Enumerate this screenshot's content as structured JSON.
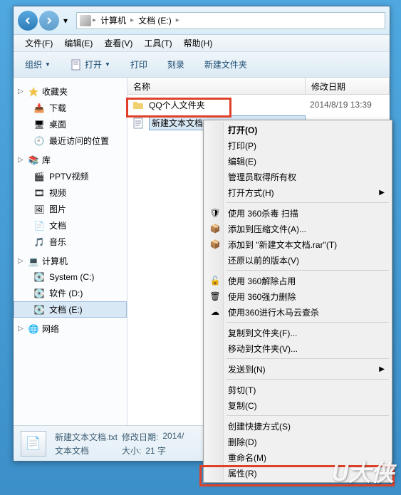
{
  "breadcrumb": {
    "seg1": "计算机",
    "seg2": "文档 (E:)"
  },
  "menubar": {
    "file": "文件(F)",
    "edit": "编辑(E)",
    "view": "查看(V)",
    "tools": "工具(T)",
    "help": "帮助(H)"
  },
  "toolbar": {
    "organize": "组织",
    "open": "打开",
    "print": "打印",
    "burn": "刻录",
    "newfolder": "新建文件夹"
  },
  "sidebar": {
    "favorites": {
      "label": "收藏夹",
      "items": [
        "下载",
        "桌面",
        "最近访问的位置"
      ]
    },
    "libraries": {
      "label": "库",
      "items": [
        "PPTV视频",
        "视频",
        "图片",
        "文档",
        "音乐"
      ]
    },
    "computer": {
      "label": "计算机",
      "items": [
        "System (C:)",
        "软件 (D:)",
        "文档 (E:)"
      ]
    },
    "network": {
      "label": "网络"
    }
  },
  "columns": {
    "name": "名称",
    "date": "修改日期"
  },
  "files": [
    {
      "name": "QQ个人文件夹",
      "date": "2014/8/19 13:39",
      "type": "folder"
    },
    {
      "name": "新建文本文档",
      "date": "",
      "type": "txt",
      "selected": true
    }
  ],
  "status": {
    "filename": "新建文本文档.txt",
    "type": "文本文档",
    "datelabel": "修改日期:",
    "dateval": "2014/",
    "sizelabel": "大小:",
    "sizeval": "21 字"
  },
  "context": {
    "open": "打开(O)",
    "print": "打印(P)",
    "edit": "编辑(E)",
    "admin": "管理员取得所有权",
    "openwith": "打开方式(H)",
    "scan360": "使用 360杀毒 扫描",
    "addarchive": "添加到压缩文件(A)...",
    "addrar": "添加到 \"新建文本文档.rar\"(T)",
    "restore": "还原以前的版本(V)",
    "unlock360": "使用 360解除占用",
    "forcedel360": "使用 360强力删除",
    "cloud360": "使用360进行木马云查杀",
    "copyfolder": "复制到文件夹(F)...",
    "movefolder": "移动到文件夹(V)...",
    "sendto": "发送到(N)",
    "cut": "剪切(T)",
    "copy": "复制(C)",
    "shortcut": "创建快捷方式(S)",
    "delete": "删除(D)",
    "rename": "重命名(M)",
    "properties": "属性(R)"
  },
  "watermark": "U大侠"
}
